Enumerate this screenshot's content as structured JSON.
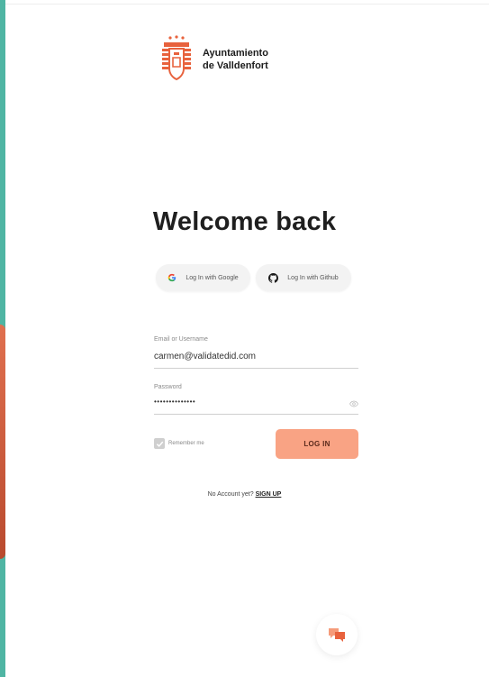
{
  "brand": {
    "name_line1": "Ayuntamiento",
    "name_line2": "de Valldenfort",
    "logo_icon": "city-crest-icon",
    "accent_color": "#e8623d"
  },
  "page": {
    "title": "Welcome back"
  },
  "social": {
    "google_label": "Log In with Google",
    "github_label": "Log In with Github"
  },
  "form": {
    "email_label": "Email or Username",
    "email_value": "carmen@validatedid.com",
    "password_label": "Password",
    "password_value": "••••••••••••••",
    "remember_label": "Remember me",
    "login_label": "LOG IN"
  },
  "signup": {
    "prompt": "No Account yet?",
    "link": "SIGN UP"
  },
  "colors": {
    "button": "#f9a384",
    "left_stripe": "#4fb5a3"
  }
}
